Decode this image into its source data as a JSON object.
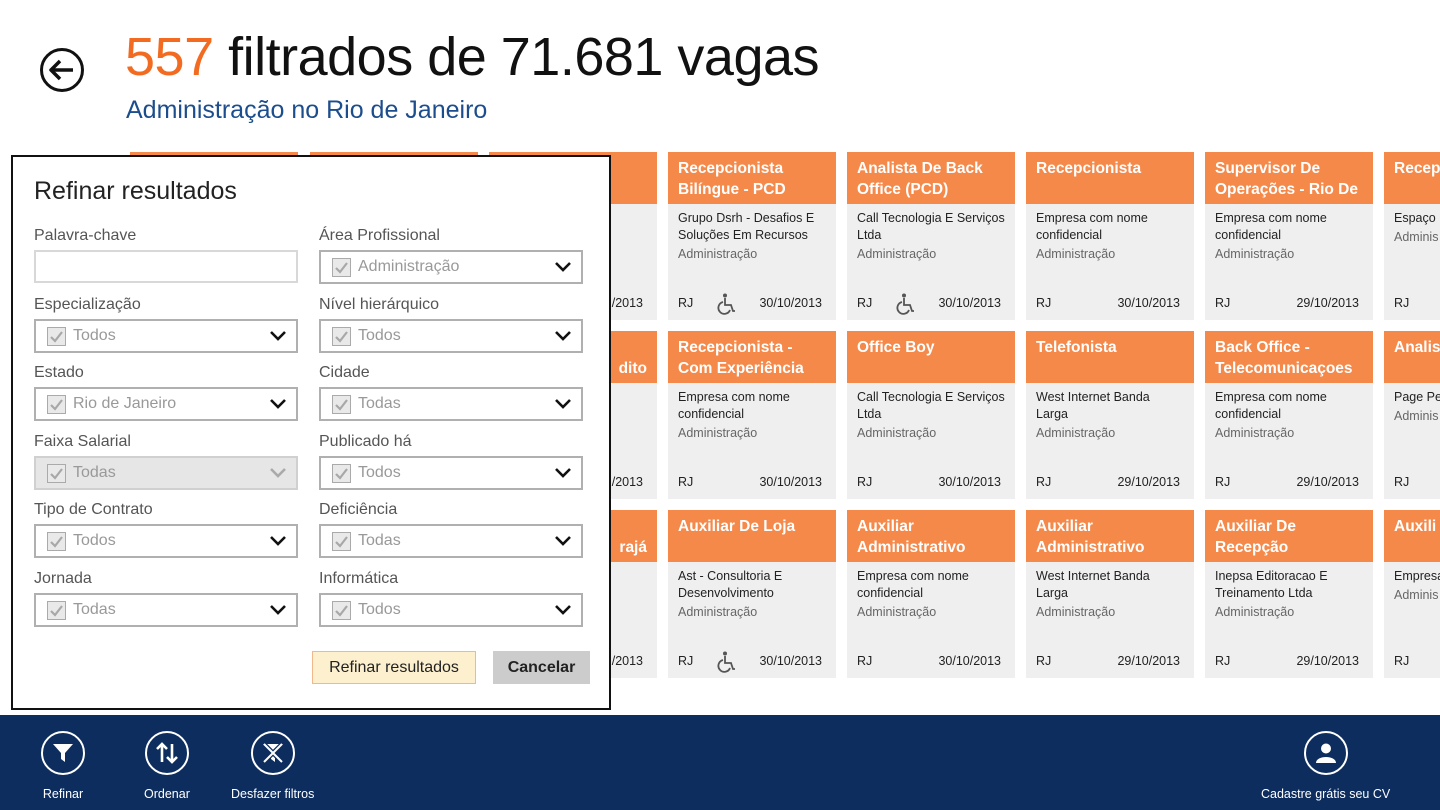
{
  "header": {
    "count": "557",
    "title_rest": " filtrados de 71.681 vagas",
    "subtitle": "Administração no Rio de Janeiro"
  },
  "cards": [
    {
      "title": "Recepcionista Bilíngue - PCD",
      "company": "Grupo Dsrh - Desafios E Soluções Em Recursos",
      "area": "Administração",
      "state": "RJ",
      "date": "30/10/2013",
      "accessible": true
    },
    {
      "title": "Analista De Back Office (PCD)",
      "company": "Call Tecnologia E Serviços Ltda",
      "area": "Administração",
      "state": "RJ",
      "date": "30/10/2013",
      "accessible": true
    },
    {
      "title": "Recepcionista",
      "company": "Empresa com nome confidencial",
      "area": "Administração",
      "state": "RJ",
      "date": "30/10/2013",
      "accessible": false
    },
    {
      "title": "Supervisor De Operações - Rio De",
      "company": "Empresa com nome confidencial",
      "area": "Administração",
      "state": "RJ",
      "date": "29/10/2013",
      "accessible": false
    },
    {
      "title": "Recep Recrei",
      "company": "Espaço I",
      "area": "Adminis",
      "state": "RJ",
      "date": "",
      "accessible": false
    },
    {
      "title": "Recepcionista - Com Experiência",
      "company": "Empresa com nome confidencial",
      "area": "Administração",
      "state": "RJ",
      "date": "30/10/2013",
      "accessible": false
    },
    {
      "title": "Office Boy",
      "company": "Call Tecnologia E Serviços Ltda",
      "area": "Administração",
      "state": "RJ",
      "date": "30/10/2013",
      "accessible": false
    },
    {
      "title": "Telefonista",
      "company": "West Internet Banda Larga",
      "area": "Administração",
      "state": "RJ",
      "date": "29/10/2013",
      "accessible": false
    },
    {
      "title": "Back Office - Telecomunicaçoes",
      "company": "Empresa com nome confidencial",
      "area": "Administração",
      "state": "RJ",
      "date": "29/10/2013",
      "accessible": false
    },
    {
      "title": "Analis Proces",
      "company": "Page Pe",
      "area": "Adminis",
      "state": "RJ",
      "date": "",
      "accessible": false
    },
    {
      "title": "Auxiliar De Loja",
      "company": "Ast - Consultoria E Desenvolvimento",
      "area": "Administração",
      "state": "RJ",
      "date": "30/10/2013",
      "accessible": true
    },
    {
      "title": "Auxiliar Administrativo",
      "company": "Empresa com nome confidencial",
      "area": "Administração",
      "state": "RJ",
      "date": "30/10/2013",
      "accessible": false
    },
    {
      "title": "Auxiliar Administrativo",
      "company": "West Internet Banda Larga",
      "area": "Administração",
      "state": "RJ",
      "date": "29/10/2013",
      "accessible": false
    },
    {
      "title": "Auxiliar De Recepção",
      "company": "Inepsa Editoracao E Treinamento Ltda",
      "area": "Administração",
      "state": "RJ",
      "date": "29/10/2013",
      "accessible": false
    },
    {
      "title": "Auxili Admin",
      "company": "Empresa confider",
      "area": "Adminis",
      "state": "RJ",
      "date": "",
      "accessible": false
    }
  ],
  "behind_fragments": {
    "row1_date": "/2013",
    "row2_title": "dito",
    "row2_date": "/2013",
    "row3_title": "rajá",
    "row3_date": "/2013"
  },
  "panel": {
    "title": "Refinar resultados",
    "keyword_label": "Palavra-chave",
    "keyword_value": "",
    "fields": [
      {
        "label": "Área Profissional",
        "value": "Administração",
        "disabled": false
      },
      {
        "label": "Especialização",
        "value": "Todos",
        "disabled": false
      },
      {
        "label": "Nível hierárquico",
        "value": "Todos",
        "disabled": false
      },
      {
        "label": "Estado",
        "value": "Rio de Janeiro",
        "disabled": false
      },
      {
        "label": "Cidade",
        "value": "Todas",
        "disabled": false
      },
      {
        "label": "Faixa Salarial",
        "value": "Todas",
        "disabled": true
      },
      {
        "label": "Publicado há",
        "value": "Todos",
        "disabled": false
      },
      {
        "label": "Tipo de Contrato",
        "value": "Todos",
        "disabled": false
      },
      {
        "label": "Deficiência",
        "value": "Todas",
        "disabled": false
      },
      {
        "label": "Jornada",
        "value": "Todas",
        "disabled": false
      },
      {
        "label": "Informática",
        "value": "Todos",
        "disabled": false
      }
    ],
    "refine_button": "Refinar resultados",
    "cancel_button": "Cancelar"
  },
  "appbar": {
    "refine": "Refinar",
    "sort": "Ordenar",
    "undo": "Desfazer filtros",
    "register": "Cadastre grátis seu CV",
    "icons": [
      "filter-icon",
      "sort-icon",
      "clear-filter-icon",
      "user-icon"
    ]
  },
  "colors": {
    "accent_orange": "#f26b21",
    "card_header": "#f5894a",
    "subtitle_blue": "#1c4d8c",
    "appbar_bg": "#0d2d5e"
  }
}
